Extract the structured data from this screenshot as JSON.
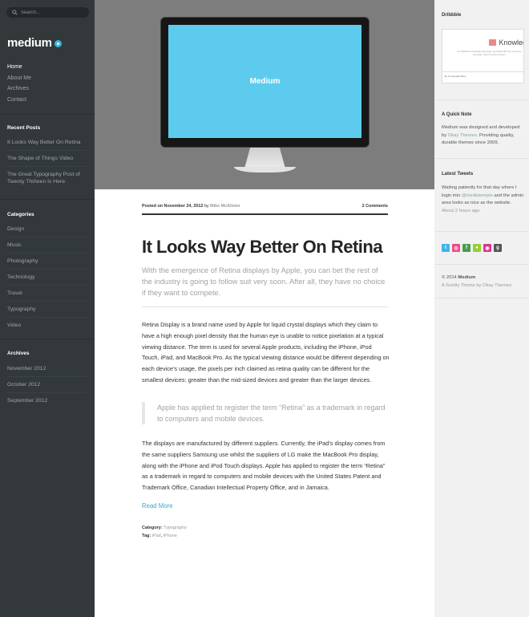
{
  "search": {
    "placeholder": "Search..."
  },
  "site": {
    "name": "medium"
  },
  "nav": [
    {
      "label": "Home",
      "active": true
    },
    {
      "label": "About Me"
    },
    {
      "label": "Archives"
    },
    {
      "label": "Contact"
    }
  ],
  "recent_posts": {
    "title": "Recent Posts",
    "items": [
      "It Looks Way Better On Retina",
      "The Shape of Things Video",
      "The Great Typography Post of Twenty Thirteen Is Here"
    ]
  },
  "categories": {
    "title": "Categories",
    "items": [
      "Design",
      "Music",
      "Photography",
      "Technology",
      "Travel",
      "Typography",
      "Video"
    ]
  },
  "archives": {
    "title": "Archives",
    "items": [
      "November 2012",
      "October 2012",
      "September 2012"
    ]
  },
  "hero": {
    "screen_text": "Medium"
  },
  "post": {
    "posted_on": "Posted on November 24, 2012",
    "by": "by",
    "author": "Mike McAlister",
    "comments": "2 Comments",
    "title": "It Looks Way Better On Retina",
    "lead": "With the emergence of Retina displays by Apple, you can bet the rest of the industry is going to follow suit very soon. After all, they have no choice if they want to compete.",
    "p1": "Retina Display is a brand name used by Apple for liquid crystal displays which they claim to have a high enough pixel density that the human eye is unable to notice pixelation at a typical viewing distance. The term is used for several Apple products, including the iPhone, iPod Touch, iPad, and MacBook Pro. As the typical viewing distance would be different depending on each device’s usage, the pixels per inch claimed as retina quality can be different for the smallest devices: greater than the mid-sized devices and greater than the larger devices.",
    "quote": "Apple has applied to register the term “Retina” as a trademark in regard to computers and mobile devices.",
    "p2": "The displays are manufactured by different suppliers. Currently, the iPad’s display comes from the same suppliers Samsung use whilst the suppliers of LG make the MacBook Pro display, along with the iPhone and iPod Touch displays. Apple has applied to register the term “Retina” as a trademark in regard to computers and mobile devices with the United States Patent and Trademark Office, Canadian Intellectual Property Office, and in Jamaica.",
    "read_more": "Read More",
    "category_label": "Category:",
    "category_value": "Typography",
    "tag_label": "Tag:",
    "tag_ipad": "iPad",
    "tag_iphone": "iPhone"
  },
  "right": {
    "dribbble_title": "Dribbble",
    "dribbble_shot": {
      "title": "Knowled",
      "text": "Our WordPress knowledge base plugin, get started with your new theme and plugin. Search and find answers.",
      "footer": "the Knowledge Base"
    },
    "note_title": "A Quick Note",
    "note_pre": "Medium was designed and developed by",
    "note_link": "Okay Themes",
    "note_post": ". Providing quality, durable themes since 2009.",
    "tweets_title": "Latest Tweets",
    "tweet_pre": "Waiting patiently for that day where I login into",
    "tweet_link": "@mediatemple",
    "tweet_post": "and the admin area looks as nice as the website.",
    "tweet_time": "About 2 hours ago",
    "copyright": "© 2014",
    "copyright_name": "Medium",
    "credit": "A Scintly Theme by Okay Themes"
  },
  "social_colors": {
    "twitter": "#3fb4e8",
    "dribbble": "#ea4c89",
    "facebook": "#4a9d4d",
    "flickr": "#9acd32",
    "github": "#e0368e",
    "google": "#555555"
  },
  "accent": "#35b8da"
}
